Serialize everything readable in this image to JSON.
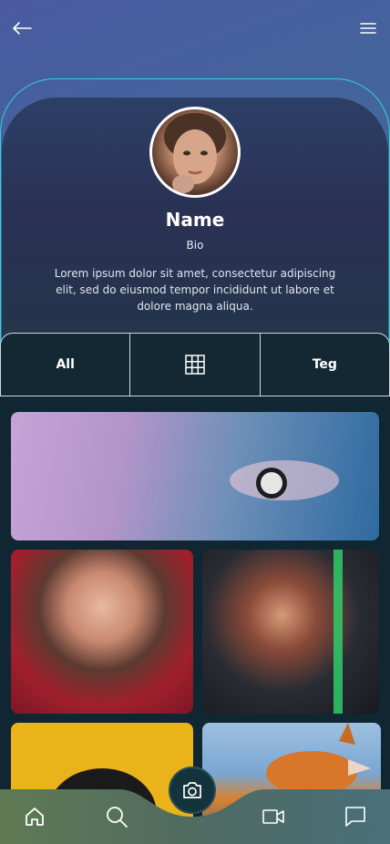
{
  "header": {
    "back_icon": "arrow-left-icon",
    "menu_icon": "hamburger-menu-icon"
  },
  "profile": {
    "name": "Name",
    "bio": "Bio",
    "description": "Lorem ipsum dolor sit amet, consectetur adipiscing elit, sed do eiusmod tempor incididunt ut labore et dolore magna aliqua."
  },
  "tabs": [
    {
      "label": "All"
    },
    {
      "label": "",
      "icon": "grid-icon"
    },
    {
      "label": "Teg"
    }
  ],
  "gallery": {
    "photos": [
      "hoodie-wristwatch",
      "smiling-woman-red-sweater",
      "woman-denim-jacket-lights",
      "yellow-background-portrait",
      "fox-in-snow"
    ]
  },
  "bottom_nav": {
    "items": [
      "home-icon",
      "search-icon",
      "camera-icon",
      "video-icon",
      "chat-icon"
    ]
  },
  "colors": {
    "accent": "#2fd3d6",
    "card": "#2a3153",
    "panel": "#142834"
  }
}
